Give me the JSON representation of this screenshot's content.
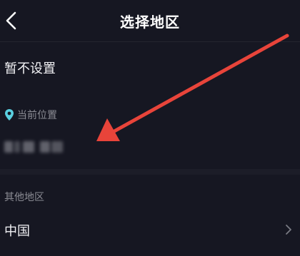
{
  "header": {
    "title": "选择地区",
    "back_icon": "chevron-left-icon"
  },
  "unset_option": {
    "label": "暂不设置"
  },
  "current_location": {
    "section_label": "当前位置",
    "pin_icon": "location-pin-icon",
    "pin_color": "#5ad0e0"
  },
  "other_regions": {
    "section_label": "其他地区",
    "items": [
      {
        "label": "中国",
        "chevron_icon": "chevron-right-icon"
      }
    ]
  },
  "annotation": {
    "arrow_color": "#e8443a"
  }
}
